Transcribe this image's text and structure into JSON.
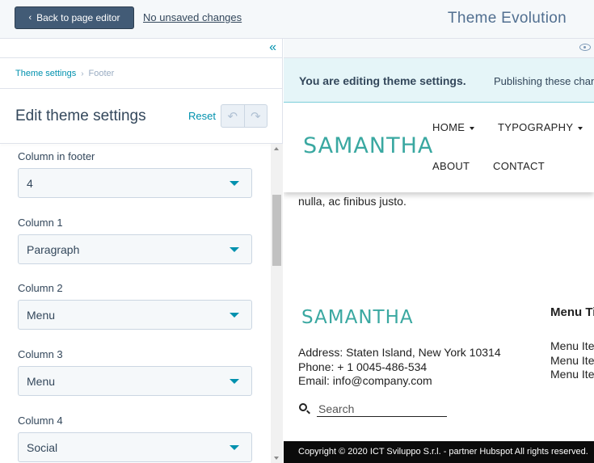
{
  "topbar": {
    "back_label": "Back to page editor",
    "unsaved_label": "No unsaved changes",
    "theme_name": "Theme Evolution"
  },
  "breadcrumb": {
    "parent": "Theme settings",
    "current": "Footer"
  },
  "panel": {
    "title": "Edit theme settings",
    "reset_label": "Reset"
  },
  "fields": [
    {
      "label": "Column in footer",
      "value": "4"
    },
    {
      "label": "Column 1",
      "value": "Paragraph"
    },
    {
      "label": "Column 2",
      "value": "Menu"
    },
    {
      "label": "Column 3",
      "value": "Menu"
    },
    {
      "label": "Column 4",
      "value": "Social"
    }
  ],
  "preview": {
    "banner_strong": "You are editing theme settings.",
    "banner_text": "Publishing these chan",
    "logo": "SAMANTHA",
    "nav": [
      {
        "label": "HOME",
        "dropdown": true
      },
      {
        "label": "TYPOGRAPHY",
        "dropdown": true
      },
      {
        "label": "ABOUT",
        "dropdown": false
      },
      {
        "label": "CONTACT",
        "dropdown": false
      }
    ],
    "body_text": "nulla, ac finibus justo.",
    "footer_logo": "SAMANTHA",
    "address_lines": [
      "Address: Staten Island, New York 10314",
      "Phone: + 1 0045-486-534",
      "Email: info@company.com"
    ],
    "search_placeholder": "Search",
    "menu_title": "Menu Tit",
    "menu_items": [
      "Menu Ite",
      "Menu Ite",
      "Menu Ite"
    ],
    "copyright": "Copyright © 2020 ICT Sviluppo S.r.l. - partner Hubspot All rights reserved."
  },
  "colors": {
    "accent": "#0091ae",
    "brand": "#3aa8a1",
    "back_button": "#425b76",
    "banner_bg": "#e5f5f8"
  },
  "icons": {
    "back": "chevron-left-icon",
    "collapse": "double-chevron-left-icon",
    "undo": "undo-icon",
    "redo": "redo-icon",
    "preview": "eye-icon",
    "search": "search-icon"
  }
}
